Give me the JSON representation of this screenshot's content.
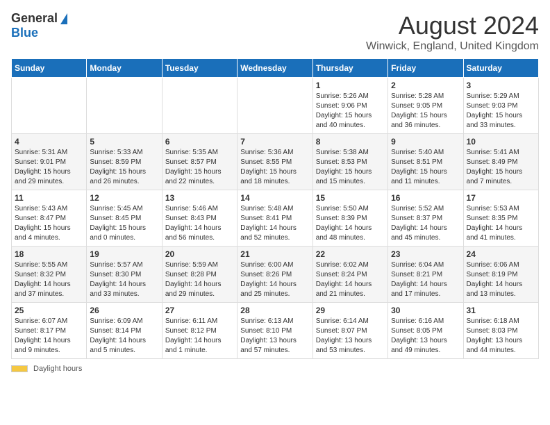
{
  "header": {
    "logo_general": "General",
    "logo_blue": "Blue",
    "title": "August 2024",
    "subtitle": "Winwick, England, United Kingdom"
  },
  "calendar": {
    "days_of_week": [
      "Sunday",
      "Monday",
      "Tuesday",
      "Wednesday",
      "Thursday",
      "Friday",
      "Saturday"
    ],
    "weeks": [
      [
        {
          "day": "",
          "info": ""
        },
        {
          "day": "",
          "info": ""
        },
        {
          "day": "",
          "info": ""
        },
        {
          "day": "",
          "info": ""
        },
        {
          "day": "1",
          "info": "Sunrise: 5:26 AM\nSunset: 9:06 PM\nDaylight: 15 hours and 40 minutes."
        },
        {
          "day": "2",
          "info": "Sunrise: 5:28 AM\nSunset: 9:05 PM\nDaylight: 15 hours and 36 minutes."
        },
        {
          "day": "3",
          "info": "Sunrise: 5:29 AM\nSunset: 9:03 PM\nDaylight: 15 hours and 33 minutes."
        }
      ],
      [
        {
          "day": "4",
          "info": "Sunrise: 5:31 AM\nSunset: 9:01 PM\nDaylight: 15 hours and 29 minutes."
        },
        {
          "day": "5",
          "info": "Sunrise: 5:33 AM\nSunset: 8:59 PM\nDaylight: 15 hours and 26 minutes."
        },
        {
          "day": "6",
          "info": "Sunrise: 5:35 AM\nSunset: 8:57 PM\nDaylight: 15 hours and 22 minutes."
        },
        {
          "day": "7",
          "info": "Sunrise: 5:36 AM\nSunset: 8:55 PM\nDaylight: 15 hours and 18 minutes."
        },
        {
          "day": "8",
          "info": "Sunrise: 5:38 AM\nSunset: 8:53 PM\nDaylight: 15 hours and 15 minutes."
        },
        {
          "day": "9",
          "info": "Sunrise: 5:40 AM\nSunset: 8:51 PM\nDaylight: 15 hours and 11 minutes."
        },
        {
          "day": "10",
          "info": "Sunrise: 5:41 AM\nSunset: 8:49 PM\nDaylight: 15 hours and 7 minutes."
        }
      ],
      [
        {
          "day": "11",
          "info": "Sunrise: 5:43 AM\nSunset: 8:47 PM\nDaylight: 15 hours and 4 minutes."
        },
        {
          "day": "12",
          "info": "Sunrise: 5:45 AM\nSunset: 8:45 PM\nDaylight: 15 hours and 0 minutes."
        },
        {
          "day": "13",
          "info": "Sunrise: 5:46 AM\nSunset: 8:43 PM\nDaylight: 14 hours and 56 minutes."
        },
        {
          "day": "14",
          "info": "Sunrise: 5:48 AM\nSunset: 8:41 PM\nDaylight: 14 hours and 52 minutes."
        },
        {
          "day": "15",
          "info": "Sunrise: 5:50 AM\nSunset: 8:39 PM\nDaylight: 14 hours and 48 minutes."
        },
        {
          "day": "16",
          "info": "Sunrise: 5:52 AM\nSunset: 8:37 PM\nDaylight: 14 hours and 45 minutes."
        },
        {
          "day": "17",
          "info": "Sunrise: 5:53 AM\nSunset: 8:35 PM\nDaylight: 14 hours and 41 minutes."
        }
      ],
      [
        {
          "day": "18",
          "info": "Sunrise: 5:55 AM\nSunset: 8:32 PM\nDaylight: 14 hours and 37 minutes."
        },
        {
          "day": "19",
          "info": "Sunrise: 5:57 AM\nSunset: 8:30 PM\nDaylight: 14 hours and 33 minutes."
        },
        {
          "day": "20",
          "info": "Sunrise: 5:59 AM\nSunset: 8:28 PM\nDaylight: 14 hours and 29 minutes."
        },
        {
          "day": "21",
          "info": "Sunrise: 6:00 AM\nSunset: 8:26 PM\nDaylight: 14 hours and 25 minutes."
        },
        {
          "day": "22",
          "info": "Sunrise: 6:02 AM\nSunset: 8:24 PM\nDaylight: 14 hours and 21 minutes."
        },
        {
          "day": "23",
          "info": "Sunrise: 6:04 AM\nSunset: 8:21 PM\nDaylight: 14 hours and 17 minutes."
        },
        {
          "day": "24",
          "info": "Sunrise: 6:06 AM\nSunset: 8:19 PM\nDaylight: 14 hours and 13 minutes."
        }
      ],
      [
        {
          "day": "25",
          "info": "Sunrise: 6:07 AM\nSunset: 8:17 PM\nDaylight: 14 hours and 9 minutes."
        },
        {
          "day": "26",
          "info": "Sunrise: 6:09 AM\nSunset: 8:14 PM\nDaylight: 14 hours and 5 minutes."
        },
        {
          "day": "27",
          "info": "Sunrise: 6:11 AM\nSunset: 8:12 PM\nDaylight: 14 hours and 1 minute."
        },
        {
          "day": "28",
          "info": "Sunrise: 6:13 AM\nSunset: 8:10 PM\nDaylight: 13 hours and 57 minutes."
        },
        {
          "day": "29",
          "info": "Sunrise: 6:14 AM\nSunset: 8:07 PM\nDaylight: 13 hours and 53 minutes."
        },
        {
          "day": "30",
          "info": "Sunrise: 6:16 AM\nSunset: 8:05 PM\nDaylight: 13 hours and 49 minutes."
        },
        {
          "day": "31",
          "info": "Sunrise: 6:18 AM\nSunset: 8:03 PM\nDaylight: 13 hours and 44 minutes."
        }
      ]
    ]
  },
  "footer": {
    "daylight_label": "Daylight hours"
  }
}
